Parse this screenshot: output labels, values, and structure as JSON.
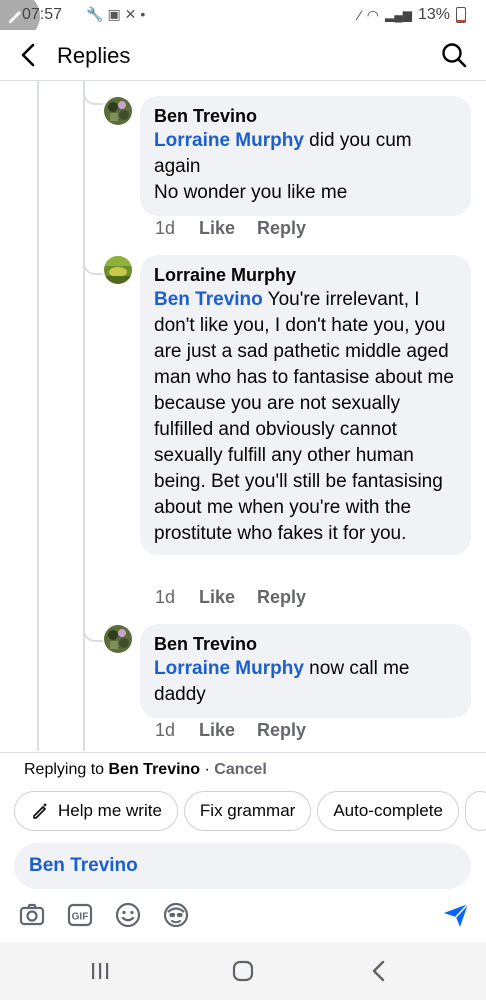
{
  "status_bar": {
    "time": "07:57",
    "battery": "13%"
  },
  "header": {
    "title": "Replies"
  },
  "comments": [
    {
      "author": "Ben Trevino",
      "mention": "Lorraine Murphy",
      "text_after_mention": " did you cum again",
      "text_line2": "No wonder you like me",
      "time": "1d",
      "like_label": "Like",
      "reply_label": "Reply"
    },
    {
      "author": "Lorraine Murphy",
      "mention": "Ben Trevino",
      "text_after_mention": " You're irrelevant, I don't like you, I don't hate you, you are just a sad pathetic middle aged man who has to fantasise about me because you are not sexually fulfilled and obviously cannot sexually fulfill any other human being. Bet you'll still be fantasising about me when you're with the prostitute who fakes it for you.",
      "time": "1d",
      "like_label": "Like",
      "reply_label": "Reply"
    },
    {
      "author": "Ben Trevino",
      "mention": "Lorraine Murphy",
      "text_after_mention": " now call me daddy",
      "time": "1d",
      "like_label": "Like",
      "reply_label": "Reply"
    }
  ],
  "composer": {
    "replying_prefix": "Replying to ",
    "replying_name": "Ben Trevino",
    "replying_sep": " · ",
    "cancel_label": "Cancel",
    "chips": [
      "Help me write",
      "Fix grammar",
      "Auto-complete"
    ],
    "input_value": "Ben Trevino",
    "accent_color": "#1b5fcf"
  },
  "icons": {
    "toolbar": [
      "camera-icon",
      "gif-icon",
      "emoji-icon",
      "avatar-sticker-icon",
      "send-icon"
    ],
    "nav": [
      "recent-apps-icon",
      "home-icon",
      "back-icon"
    ]
  }
}
